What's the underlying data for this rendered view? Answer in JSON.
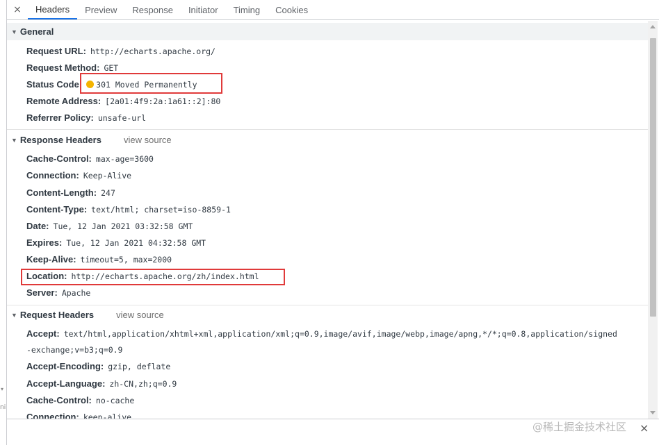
{
  "tabs": {
    "close": "×",
    "items": [
      "Headers",
      "Preview",
      "Response",
      "Initiator",
      "Timing",
      "Cookies"
    ],
    "active": "Headers"
  },
  "general": {
    "title": "General",
    "rows": [
      {
        "key": "Request URL:",
        "value": "http://echarts.apache.org/"
      },
      {
        "key": "Request Method:",
        "value": "GET"
      },
      {
        "key": "Status Code:",
        "value": "301 Moved Permanently",
        "status_dot_color": "#f4b400"
      },
      {
        "key": "Remote Address:",
        "value": "[2a01:4f9:2a:1a61::2]:80"
      },
      {
        "key": "Referrer Policy:",
        "value": "unsafe-url"
      }
    ]
  },
  "response_headers": {
    "title": "Response Headers",
    "view_source": "view source",
    "rows": [
      {
        "key": "Cache-Control:",
        "value": "max-age=3600"
      },
      {
        "key": "Connection:",
        "value": "Keep-Alive"
      },
      {
        "key": "Content-Length:",
        "value": "247"
      },
      {
        "key": "Content-Type:",
        "value": "text/html; charset=iso-8859-1"
      },
      {
        "key": "Date:",
        "value": "Tue, 12 Jan 2021 03:32:58 GMT"
      },
      {
        "key": "Expires:",
        "value": "Tue, 12 Jan 2021 04:32:58 GMT"
      },
      {
        "key": "Keep-Alive:",
        "value": "timeout=5, max=2000"
      },
      {
        "key": "Location:",
        "value": "http://echarts.apache.org/zh/index.html"
      },
      {
        "key": "Server:",
        "value": "Apache"
      }
    ]
  },
  "request_headers": {
    "title": "Request Headers",
    "view_source": "view source",
    "rows": [
      {
        "key": "Accept:",
        "value": "text/html,application/xhtml+xml,application/xml;q=0.9,image/avif,image/webp,image/apng,*/*;q=0.8,application/signed",
        "continuation": "-exchange;v=b3;q=0.9"
      },
      {
        "key": "Accept-Encoding:",
        "value": "gzip, deflate"
      },
      {
        "key": "Accept-Language:",
        "value": "zh-CN,zh;q=0.9"
      },
      {
        "key": "Cache-Control:",
        "value": "no-cache"
      },
      {
        "key": "Connection:",
        "value": "keep-alive"
      }
    ]
  },
  "left_gutter": {
    "mark": "▾",
    "fragment": "ni"
  },
  "bottom": {
    "watermark": "@稀土掘金技术社区",
    "close": "×"
  },
  "colors": {
    "highlight_box": "#e03a3a",
    "active_tab_underline": "#1a73e8",
    "status_dot": "#f4b400"
  }
}
